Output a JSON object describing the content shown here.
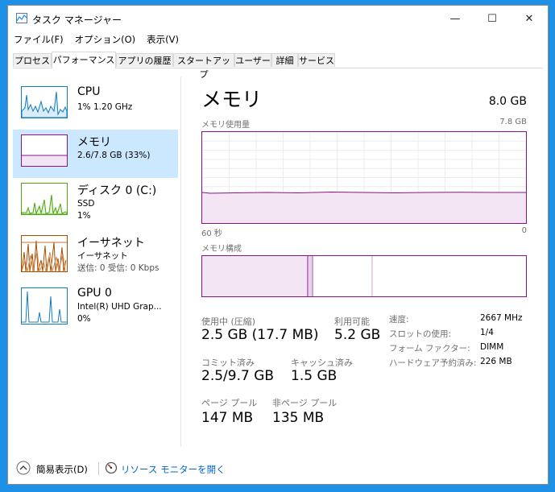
{
  "window": {
    "title": "タスク マネージャー",
    "minimize": "—",
    "maximize": "☐",
    "close": "✕"
  },
  "menu": [
    "ファイル(F)",
    "オプション(O)",
    "表示(V)"
  ],
  "tabs": [
    "プロセス",
    "パフォーマンス",
    "アプリの履歴",
    "スタートアップ",
    "ユーザー",
    "詳細",
    "サービス"
  ],
  "active_tab": "パフォーマンス",
  "sidebar": [
    {
      "title": "CPU",
      "sub1": "1%  1.20 GHz",
      "sub2": "",
      "sub3": "",
      "color": "#117dbb"
    },
    {
      "title": "メモリ",
      "sub1": "2.6/7.8 GB (33%)",
      "sub2": "",
      "sub3": "",
      "color": "#8b128b"
    },
    {
      "title": "ディスク 0 (C:)",
      "sub1": "SSD",
      "sub2": "1%",
      "sub3": "",
      "color": "#4da60c"
    },
    {
      "title": "イーサネット",
      "sub1": "イーサネット",
      "sub2": "送信: 0 受信: 0 Kbps",
      "sub3": "",
      "color": "#a74f01"
    },
    {
      "title": "GPU 0",
      "sub1": "Intel(R) UHD Grap...",
      "sub2": "0%",
      "sub3": "",
      "color": "#117dbb"
    }
  ],
  "memory": {
    "title": "メモリ",
    "total": "8.0 GB",
    "usage_label": "メモリ使用量",
    "usage_max": "7.8 GB",
    "time_left": "60 秒",
    "time_right": "0",
    "composition_label": "メモリ構成",
    "usage_fraction": 0.33,
    "stats": {
      "in_use_label": "使用中 (圧縮)",
      "in_use": "2.5 GB (17.7 MB)",
      "available_label": "利用可能",
      "available": "5.2 GB",
      "committed_label": "コミット済み",
      "committed": "2.5/9.7 GB",
      "cached_label": "キャッシュ済み",
      "cached": "1.5 GB",
      "paged_label": "ページ プール",
      "paged": "147 MB",
      "nonpaged_label": "非ページ プール",
      "nonpaged": "135 MB"
    },
    "right": [
      {
        "label": "速度:",
        "value": "2667 MHz"
      },
      {
        "label": "スロットの使用:",
        "value": "1/4"
      },
      {
        "label": "フォーム ファクター:",
        "value": "DIMM"
      },
      {
        "label": "ハードウェア予約済み:",
        "value": "226 MB"
      }
    ]
  },
  "footer": {
    "simple_view": "簡易表示(D)",
    "resource_monitor": "リソース モニターを開く"
  },
  "colors": {
    "memory_accent": "#8b128b",
    "link": "#0066cc",
    "selected_bg": "#cce8ff"
  }
}
